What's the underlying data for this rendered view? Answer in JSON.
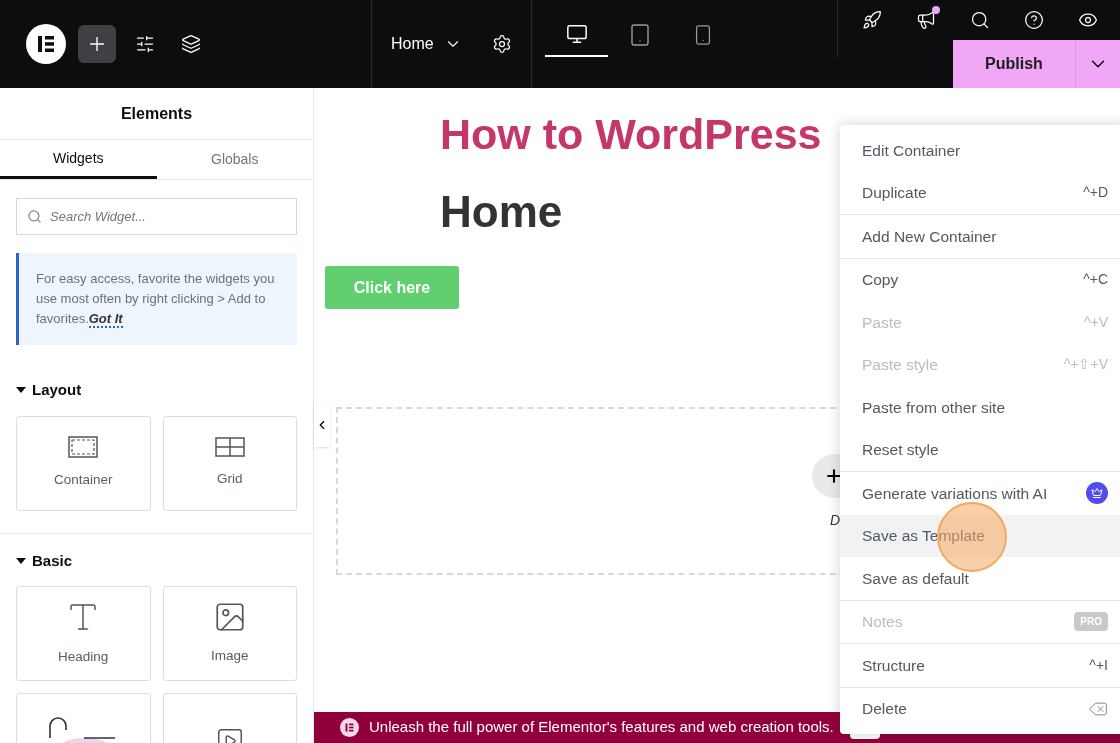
{
  "toolbar": {
    "add_selected": true,
    "page": "Home",
    "devices": [
      {
        "kind": "desktop",
        "selected": true
      },
      {
        "kind": "tablet",
        "selected": false
      },
      {
        "kind": "mobile",
        "selected": false
      }
    ],
    "notification_dot": true,
    "publish": "Publish"
  },
  "panel": {
    "title": "Elements",
    "tabs": [
      {
        "label": "Widgets",
        "selected": true
      },
      {
        "label": "Globals",
        "selected": false
      }
    ],
    "search": {
      "placeholder": "Search Widget..."
    },
    "tip": "For easy access, favorite the widgets you use most often by right clicking > Add to favorites.",
    "tip_link": "Got It",
    "sections": [
      {
        "title": "Layout",
        "expanded": true,
        "widgets": [
          {
            "kind": "container",
            "label": "Container"
          },
          {
            "kind": "grid",
            "label": "Grid"
          }
        ]
      },
      {
        "title": "Basic",
        "expanded": true,
        "widgets": [
          {
            "kind": "heading",
            "label": "Heading"
          },
          {
            "kind": "image",
            "label": "Image"
          },
          {
            "kind": "illustration"
          },
          {
            "kind": "video"
          }
        ]
      }
    ]
  },
  "canvas": {
    "site_title": "How to WordPress",
    "page_heading": "Home",
    "button": "Click here",
    "drop_hint": "D",
    "banner": "Unleash the full power of Elementor's features and web creation tools."
  },
  "context_menu": {
    "groups": [
      [
        {
          "label": "Edit Container",
          "disabled": false,
          "selected": false
        },
        {
          "label": "Duplicate",
          "shortcut": "^+D",
          "disabled": false,
          "selected": false
        }
      ],
      [
        {
          "label": "Add New Container",
          "disabled": false,
          "selected": false
        }
      ],
      [
        {
          "label": "Copy",
          "shortcut": "^+C",
          "disabled": false,
          "selected": false
        },
        {
          "label": "Paste",
          "shortcut": "^+V",
          "disabled": true,
          "selected": false
        },
        {
          "label": "Paste style",
          "shortcut": "^+⇧+V",
          "disabled": true,
          "selected": false
        },
        {
          "label": "Paste from other site",
          "disabled": false,
          "selected": false
        },
        {
          "label": "Reset style",
          "disabled": false,
          "selected": false
        }
      ],
      [
        {
          "label": "Generate variations with AI",
          "kind": "ai",
          "disabled": false,
          "selected": false
        },
        {
          "label": "Save as Template",
          "disabled": false,
          "selected": true,
          "clicked": true
        },
        {
          "label": "Save as default",
          "disabled": false,
          "selected": false
        }
      ],
      [
        {
          "label": "Notes",
          "badge": "PRO",
          "disabled": true,
          "selected": false
        }
      ],
      [
        {
          "label": "Structure",
          "shortcut": "^+I",
          "disabled": false,
          "selected": false
        }
      ],
      [
        {
          "label": "Delete",
          "kind": "delete",
          "disabled": false,
          "selected": false
        }
      ]
    ]
  }
}
